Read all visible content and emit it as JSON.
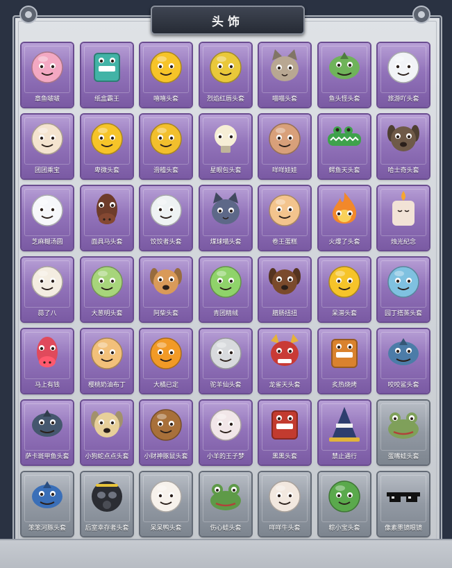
{
  "panel": {
    "title": "头饰"
  },
  "items": [
    {
      "label": "章鱼啵啵",
      "icon": "pink-octopus-icon",
      "art": "face",
      "color": "#f3a8c2",
      "bg": "purple"
    },
    {
      "label": "纸盒霸王",
      "icon": "box-dinosaur-icon",
      "art": "box",
      "color": "#42b3a6",
      "bg": "purple"
    },
    {
      "label": "嘻嘻头套",
      "icon": "grinning-emoji-icon",
      "art": "face",
      "color": "#f6c429",
      "bg": "purple"
    },
    {
      "label": "烈焰红唇头套",
      "icon": "yellow-electric-mouse-sunglasses-icon",
      "art": "face",
      "color": "#e9c83a",
      "bg": "purple"
    },
    {
      "label": "喵喵头套",
      "icon": "tabby-cat-icon",
      "art": "cat",
      "color": "#b8a792",
      "bg": "purple"
    },
    {
      "label": "鱼头怪头套",
      "icon": "green-fish-head-icon",
      "art": "fish",
      "color": "#6fb35a",
      "bg": "purple"
    },
    {
      "label": "旅游吖头套",
      "icon": "duck-with-hat-icon",
      "art": "face",
      "color": "#f2f4f7",
      "bg": "purple"
    },
    {
      "label": "团团乘宝",
      "icon": "cream-hamster-icon",
      "art": "face",
      "color": "#f4e4cf",
      "bg": "purple"
    },
    {
      "label": "卑微头套",
      "icon": "smiling-emoji-icon",
      "art": "face",
      "color": "#f6c429",
      "bg": "purple"
    },
    {
      "label": "滑稽头套",
      "icon": "sly-emoji-icon",
      "art": "face",
      "color": "#f2bf2d",
      "bg": "purple"
    },
    {
      "label": "星眼包头套",
      "icon": "bulb-head-icon",
      "art": "bulb",
      "color": "#f6eed6",
      "bg": "purple"
    },
    {
      "label": "咩咩娃娃",
      "icon": "girl-doll-icon",
      "art": "face",
      "color": "#d8a07a",
      "bg": "purple"
    },
    {
      "label": "鳄鱼天头套",
      "icon": "crocodile-icon",
      "art": "croc",
      "color": "#3fa24c",
      "bg": "purple"
    },
    {
      "label": "哈士奇头套",
      "icon": "husky-sunglasses-icon",
      "art": "dog",
      "color": "#6f5a48",
      "bg": "purple"
    },
    {
      "label": "芝麻糊汤圆",
      "icon": "rice-ball-flower-icon",
      "art": "face",
      "color": "#f6f7fa",
      "bg": "purple"
    },
    {
      "label": "面具马头套",
      "icon": "horse-mask-icon",
      "art": "horse",
      "color": "#6e3c2a",
      "bg": "purple"
    },
    {
      "label": "饺饺者头套",
      "icon": "dumpling-cloud-icon",
      "art": "face",
      "color": "#eef2f3",
      "bg": "purple"
    },
    {
      "label": "煤球喵头套",
      "icon": "grey-cat-icon",
      "art": "cat",
      "color": "#5d6888",
      "bg": "purple"
    },
    {
      "label": "卷王蛋糕",
      "icon": "roll-cake-icon",
      "art": "face",
      "color": "#f3c48d",
      "bg": "purple"
    },
    {
      "label": "火爆了头套",
      "icon": "fire-spirit-icon",
      "art": "fire",
      "color": "#f2882a",
      "bg": "purple"
    },
    {
      "label": "烛光纪念",
      "icon": "candle-icon",
      "art": "candle",
      "color": "#f2e3d6",
      "bg": "purple"
    },
    {
      "label": "蒜了八",
      "icon": "garlic-icon",
      "art": "face",
      "color": "#f4ede1",
      "bg": "purple"
    },
    {
      "label": "大葱明头套",
      "icon": "bok-choy-icon",
      "art": "face",
      "color": "#a7d57b",
      "bg": "purple"
    },
    {
      "label": "阿柴头套",
      "icon": "shiba-dog-icon",
      "art": "dog",
      "color": "#d99a59",
      "bg": "purple"
    },
    {
      "label": "青团精绒",
      "icon": "green-rice-ball-icon",
      "art": "face",
      "color": "#8fd36a",
      "bg": "purple"
    },
    {
      "label": "腊肠扭扭",
      "icon": "dachshund-icon",
      "art": "dog",
      "color": "#7a4a2c",
      "bg": "purple"
    },
    {
      "label": "呆滞头套",
      "icon": "dazed-emoji-icon",
      "art": "face",
      "color": "#f6c429",
      "bg": "purple"
    },
    {
      "label": "园丁搭蒸头套",
      "icon": "blue-fish-bee-icon",
      "art": "face",
      "color": "#7fc1e0",
      "bg": "purple"
    },
    {
      "label": "马上有钱",
      "icon": "red-horse-icon",
      "art": "horse",
      "color": "#e04a5c",
      "bg": "purple"
    },
    {
      "label": "樱桃奶油布丁",
      "icon": "pudding-icon",
      "art": "face",
      "color": "#f2c07a",
      "bg": "purple"
    },
    {
      "label": "大橘已定",
      "icon": "orange-slice-icon",
      "art": "face",
      "color": "#f29a26",
      "bg": "purple"
    },
    {
      "label": "驼羊仙头套",
      "icon": "white-bear-sunglasses-icon",
      "art": "face",
      "color": "#d8dadd",
      "bg": "purple"
    },
    {
      "label": "龙雀天头套",
      "icon": "dragon-mask-icon",
      "art": "dragon",
      "color": "#c93a35",
      "bg": "purple"
    },
    {
      "label": "炙热烧烤",
      "icon": "bbq-steak-icon",
      "art": "box",
      "color": "#d9822e",
      "bg": "purple"
    },
    {
      "label": "咬咬鲨头套",
      "icon": "shark-icon",
      "art": "fish",
      "color": "#4c7ca8",
      "bg": "purple"
    },
    {
      "label": "萨卡斑甲鱼头套",
      "icon": "catfish-icon",
      "art": "fish",
      "color": "#45576e",
      "bg": "purple"
    },
    {
      "label": "小狗蛇点点头套",
      "icon": "pug-dog-icon",
      "art": "dog",
      "color": "#e7cf9a",
      "bg": "purple"
    },
    {
      "label": "小财神豚鼠头套",
      "icon": "capybara-icon",
      "art": "face",
      "color": "#a8703a",
      "bg": "purple"
    },
    {
      "label": "小羊的王子梦",
      "icon": "sheep-crown-icon",
      "art": "face",
      "color": "#f1e6e8",
      "bg": "purple"
    },
    {
      "label": "黑黑头套",
      "icon": "tv-box-icon",
      "art": "box",
      "color": "#c23b2f",
      "bg": "purple"
    },
    {
      "label": "禁止通行",
      "icon": "traffic-cone-icon",
      "art": "cone",
      "color": "#2e3e6e",
      "bg": "purple"
    },
    {
      "label": "蛋嘴蛙头套",
      "icon": "frog-icon",
      "art": "frog",
      "color": "#7fa05a",
      "bg": "grey"
    },
    {
      "label": "笨笨河豚头套",
      "icon": "blue-pufferfish-icon",
      "art": "fish",
      "color": "#3a6fb8",
      "bg": "grey"
    },
    {
      "label": "后室幸存者头套",
      "icon": "gas-mask-helmet-icon",
      "art": "helmet",
      "color": "#2b2d33",
      "bg": "grey"
    },
    {
      "label": "呆呆鸭头套",
      "icon": "duck-icon",
      "art": "face",
      "color": "#f7f2ec",
      "bg": "grey"
    },
    {
      "label": "伤心蛙头套",
      "icon": "sad-frog-icon",
      "art": "frog",
      "color": "#5e9a48",
      "bg": "grey"
    },
    {
      "label": "咩咩牛头套",
      "icon": "cow-icon",
      "art": "face",
      "color": "#f2e8df",
      "bg": "grey"
    },
    {
      "label": "粽小宝头套",
      "icon": "zongzi-icon",
      "art": "face",
      "color": "#5aa94c",
      "bg": "grey"
    },
    {
      "label": "像素墨镜眼镜",
      "icon": "pixel-sunglasses-icon",
      "art": "glasses",
      "color": "#111111",
      "bg": "grey"
    }
  ]
}
